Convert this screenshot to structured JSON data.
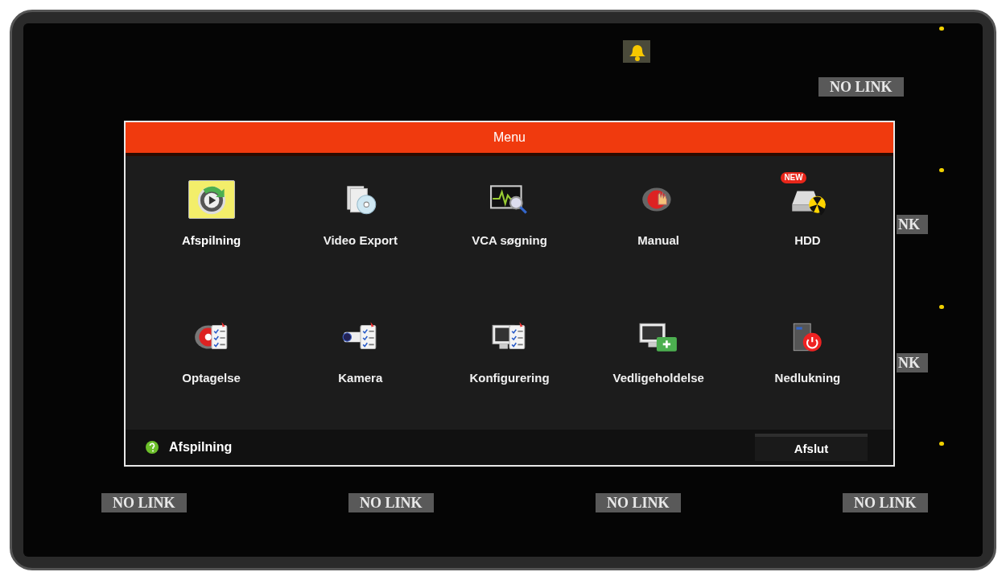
{
  "channels_top": [
    {
      "label": "NO LINK"
    },
    {
      "label": "NK"
    },
    {
      "label": "NK"
    }
  ],
  "channels_bottom": [
    {
      "label": "NO LINK"
    },
    {
      "label": "NO LINK"
    },
    {
      "label": "NO LINK"
    },
    {
      "label": "NO LINK"
    }
  ],
  "menu": {
    "title": "Menu",
    "items": [
      {
        "label": "Afspilning",
        "selected": true
      },
      {
        "label": "Video Export",
        "selected": false
      },
      {
        "label": "VCA søgning",
        "selected": false
      },
      {
        "label": "Manual",
        "selected": false
      },
      {
        "label": "HDD",
        "selected": false,
        "badge": "NEW"
      },
      {
        "label": "Optagelse",
        "selected": false
      },
      {
        "label": "Kamera",
        "selected": false
      },
      {
        "label": "Konfigurering",
        "selected": false
      },
      {
        "label": "Vedligeholdelse",
        "selected": false
      },
      {
        "label": "Nedlukning",
        "selected": false
      }
    ],
    "help": "Afspilning",
    "exit_button": "Afslut"
  }
}
